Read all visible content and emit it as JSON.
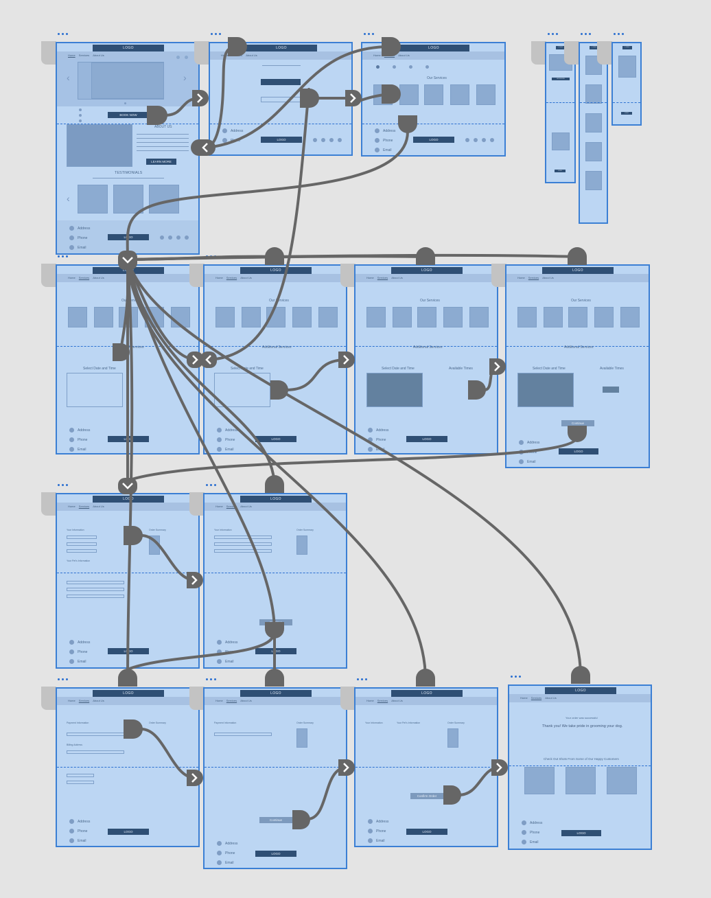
{
  "labels": {
    "logo": "LOGO",
    "nav_home": "Home",
    "nav_services": "Services",
    "nav_about": "About Us",
    "book_now": "BOOK NOW",
    "about_us": "ABOUT US",
    "learn_more": "LEARN MORE",
    "testimonials": "TESTIMONIALS",
    "address": "Address",
    "phone": "Phone",
    "email": "Email",
    "our_services": "Our Services",
    "additional_services": "Additional Services",
    "select_date_time": "Select Date and Time",
    "available_times": "Available Times",
    "continue": "Continue",
    "confirm_order": "Confirm Order",
    "order_success": "Your order was successful",
    "thank_you": "Thank you! We take pride in grooming your dog.",
    "check_out_shots": "Check Out Shots From Some of Our Happy Customers",
    "your_info": "Your Information",
    "your_pets_info": "Your Pet's Information",
    "order_summary": "Order Summary",
    "payment_info": "Payment Information",
    "billing_address": "Billing Address",
    "review": "Review"
  },
  "colors": {
    "canvas": "#e4e4e4",
    "board_fill": "#bcd6f3",
    "board_border": "#3b7fd4",
    "fold_line": "#2a6fd0",
    "dark_button": "#2f4f74",
    "connector": "#666666"
  },
  "icons": [
    "chevron-left-icon",
    "chevron-right-icon",
    "chevron-down-icon",
    "connector-handle-icon",
    "more-dots-icon"
  ]
}
